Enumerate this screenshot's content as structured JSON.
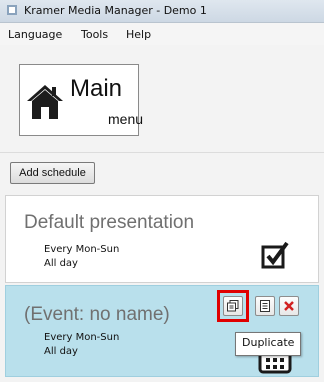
{
  "window": {
    "title": "Kramer Media Manager - Demo 1"
  },
  "menubar": {
    "items": [
      "Language",
      "Tools",
      "Help"
    ]
  },
  "main_button": {
    "title": "Main",
    "subtitle": "menu"
  },
  "toolbar": {
    "add_schedule_label": "Add schedule"
  },
  "schedules": [
    {
      "title": "Default presentation",
      "recurrence": "Every Mon-Sun",
      "time": "All day",
      "icon": "checkbox-checked-icon"
    },
    {
      "title": "(Event: no name)",
      "recurrence": "Every Mon-Sun",
      "time": "All day",
      "icon": "calendar-icon",
      "selected": true,
      "actions": [
        "duplicate-icon",
        "edit-icon",
        "delete-icon"
      ]
    }
  ],
  "tooltip": {
    "text": "Duplicate"
  },
  "colors": {
    "selected_row": "#b9e0ec",
    "highlight": "#e00000",
    "delete": "#d12020"
  }
}
